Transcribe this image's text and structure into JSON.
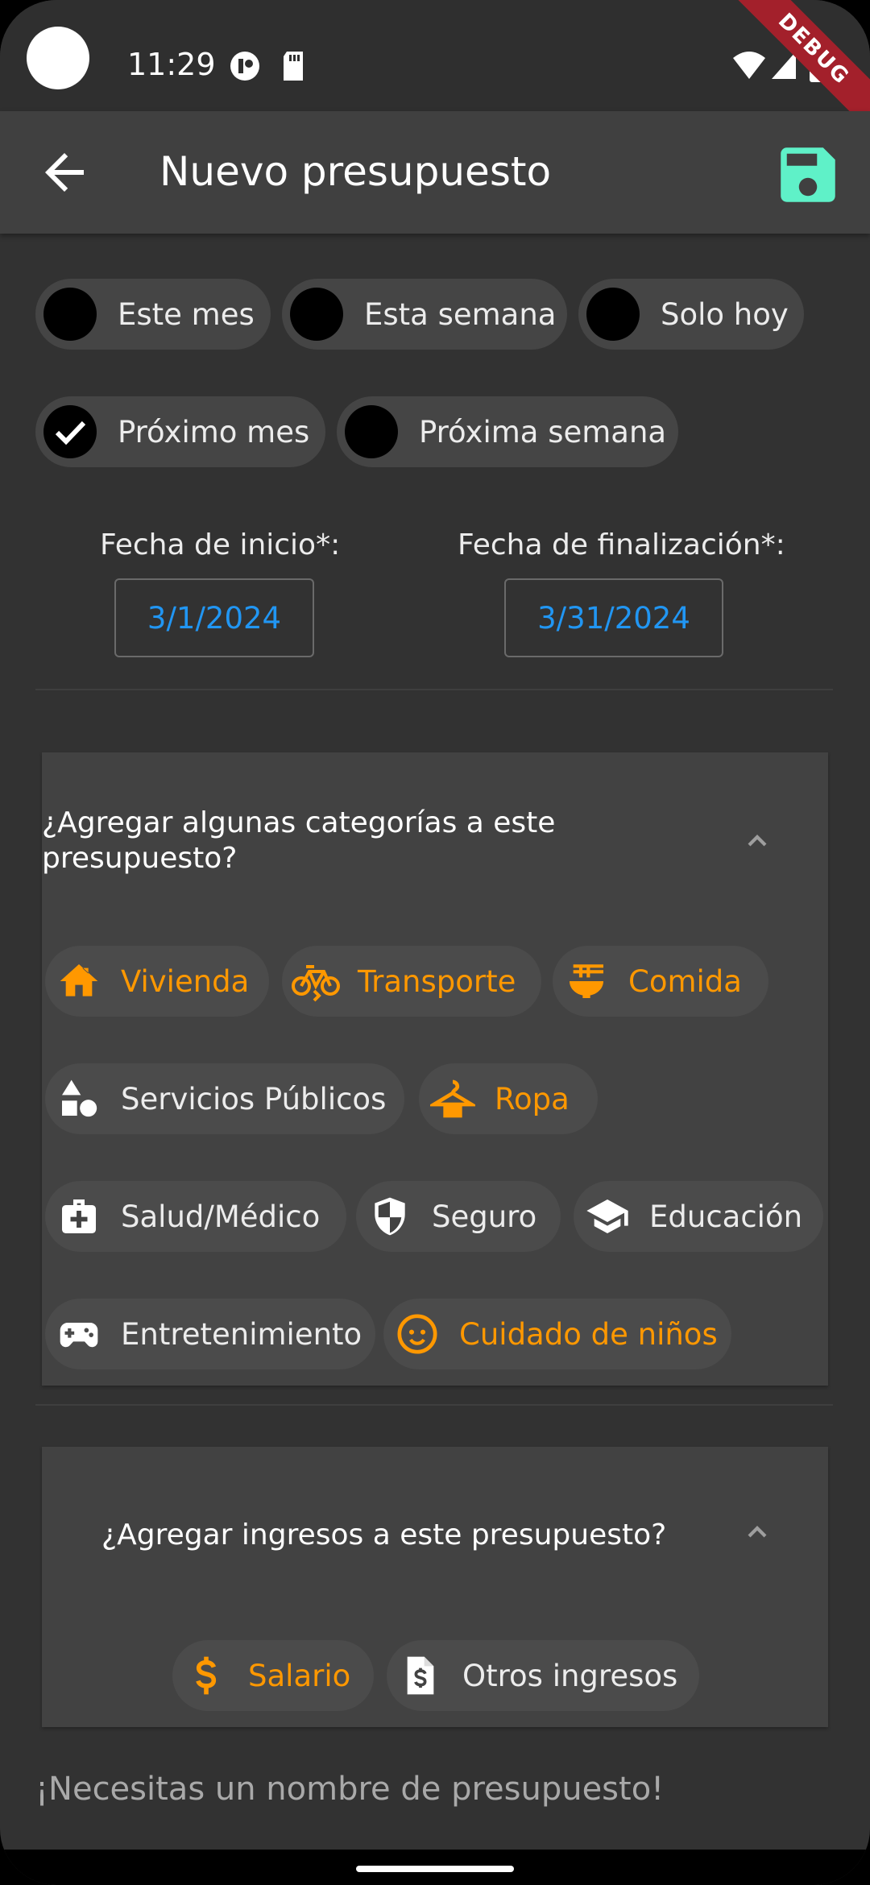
{
  "status_bar": {
    "time": "11:29",
    "debug_label": "DEBUG"
  },
  "app_bar": {
    "title": "Nuevo presupuesto",
    "back_icon": "arrow-back-icon",
    "save_icon": "floppy-disk-save-icon",
    "save_color": "#5FF1C8"
  },
  "period_options": [
    {
      "label": "Este mes",
      "selected": false
    },
    {
      "label": "Esta semana",
      "selected": false
    },
    {
      "label": "Solo hoy",
      "selected": false
    },
    {
      "label": "Próximo mes",
      "selected": true
    },
    {
      "label": "Próxima semana",
      "selected": false
    }
  ],
  "dates": {
    "start_label": "Fecha de inicio*:",
    "start_value": "3/1/2024",
    "end_label": "Fecha de finalización*:",
    "end_value": "3/31/2024",
    "value_color": "#2196F3"
  },
  "categories_panel": {
    "title_line1": "¿Agregar algunas categorías a este",
    "title_line2": "presupuesto?",
    "items": [
      {
        "label": "Vivienda",
        "icon": "house-icon",
        "selected": true
      },
      {
        "label": "Transporte",
        "icon": "bike-icon",
        "selected": true
      },
      {
        "label": "Comida",
        "icon": "noodle-bowl-icon",
        "selected": true
      },
      {
        "label": "Servicios Públicos",
        "icon": "shapes-icon",
        "selected": false
      },
      {
        "label": "Ropa",
        "icon": "hanger-icon",
        "selected": true
      },
      {
        "label": "Salud/Médico",
        "icon": "medical-bag-icon",
        "selected": false
      },
      {
        "label": "Seguro",
        "icon": "shield-icon",
        "selected": false
      },
      {
        "label": "Educación",
        "icon": "graduation-cap-icon",
        "selected": false
      },
      {
        "label": "Entretenimiento",
        "icon": "gamepad-icon",
        "selected": false
      },
      {
        "label": "Cuidado de niños",
        "icon": "child-face-icon",
        "selected": true
      }
    ]
  },
  "income_panel": {
    "title": "¿Agregar ingresos a este presupuesto?",
    "items": [
      {
        "label": "Salario",
        "icon": "dollar-icon",
        "selected": true
      },
      {
        "label": "Otros ingresos",
        "icon": "invoice-dollar-icon",
        "selected": false
      }
    ]
  },
  "validation_message": "¡Necesitas un nombre de presupuesto!",
  "colors": {
    "selected": "#FF9800",
    "unselected": "#ECECEC",
    "background": "#323232"
  }
}
